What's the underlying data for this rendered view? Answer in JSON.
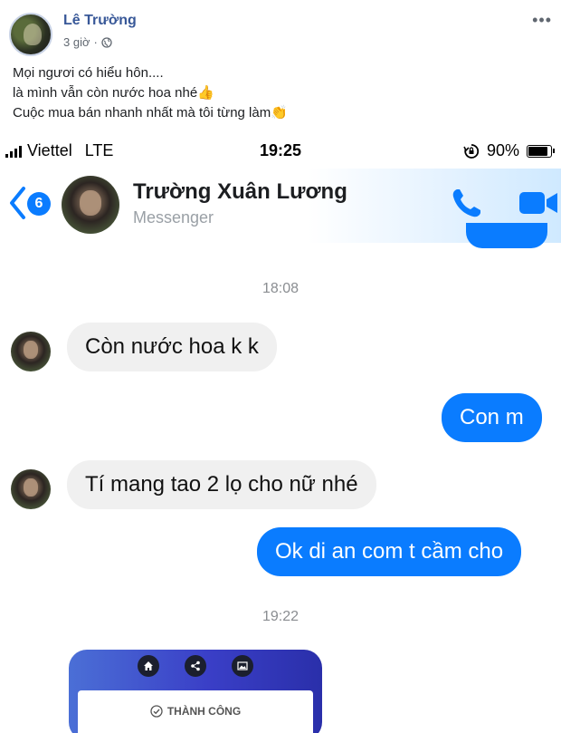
{
  "post": {
    "author": "Lê Trường",
    "time": "3 giờ",
    "privacy_icon": "globe-icon",
    "more_icon": "more-icon",
    "caption": [
      "Mọi ngươi có hiểu hôn....",
      "là mình vẫn còn nước hoa nhé👍",
      "Cuộc mua bán nhanh nhất mà tôi từng làm👏"
    ]
  },
  "status_bar": {
    "carrier": "Viettel",
    "network": "LTE",
    "time": "19:25",
    "battery": "90%"
  },
  "chat": {
    "unread_count": "6",
    "contact_name": "Trường Xuân Lương",
    "contact_sub": "Messenger",
    "accent": "#0a7cff",
    "timestamps": [
      "18:08",
      "19:22"
    ],
    "messages": [
      {
        "from": "contact",
        "text": "Còn nước hoa k k"
      },
      {
        "from": "me",
        "text": "Con m"
      },
      {
        "from": "contact",
        "text": "Tí mang tao 2 lọ cho nữ nhé"
      },
      {
        "from": "me",
        "text": "Ok di an com t cầm cho"
      }
    ],
    "image_card": {
      "status": "THÀNH CÔNG",
      "icons": [
        "home-icon",
        "share-icon",
        "image-icon"
      ]
    }
  }
}
